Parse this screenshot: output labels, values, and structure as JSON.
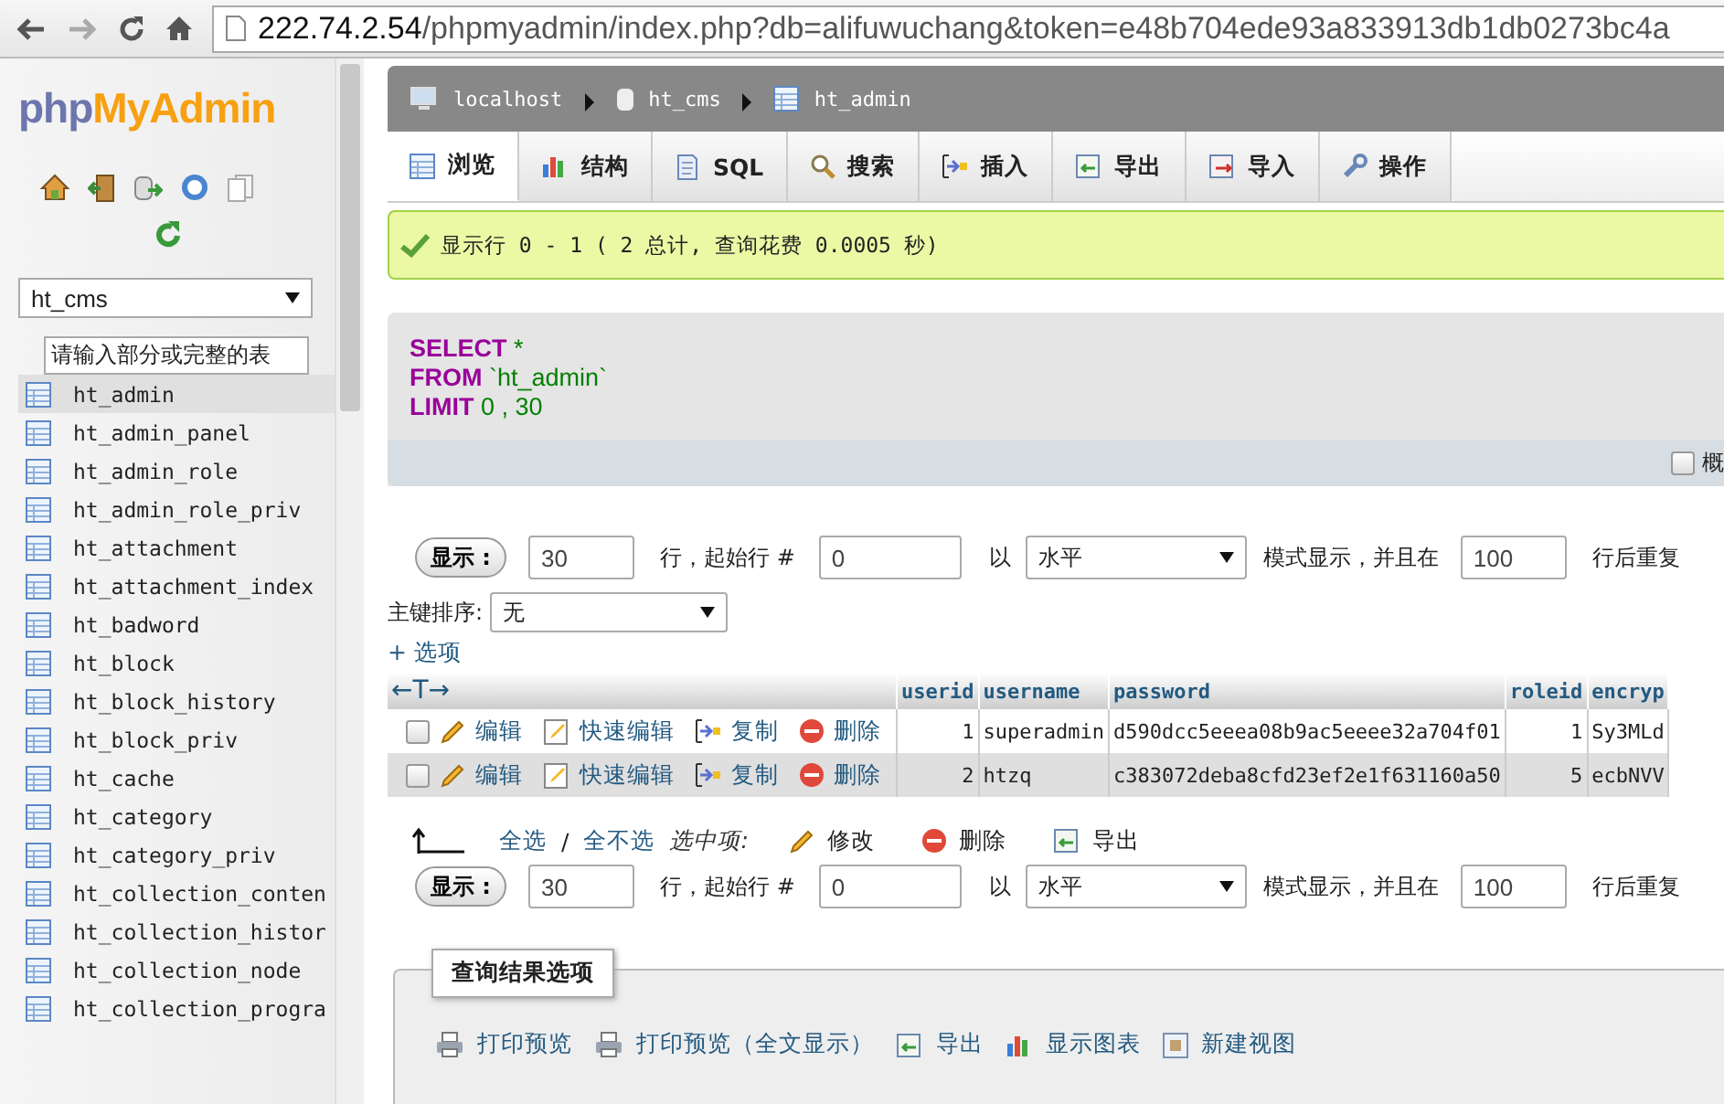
{
  "browser": {
    "url_host": "222.74.2.54",
    "url_path": "/phpmyadmin/index.php?db=alifuwuchang&token=e48b704ede93a833913db1db0273bc4a"
  },
  "sidebar": {
    "logo_php": "php",
    "logo_myadmin": "MyAdmin",
    "database": "ht_cms",
    "filter_value": "请输入部分或完整的表",
    "tables": [
      {
        "name": "ht_admin",
        "selected": true
      },
      {
        "name": "ht_admin_panel",
        "selected": false
      },
      {
        "name": "ht_admin_role",
        "selected": false
      },
      {
        "name": "ht_admin_role_priv",
        "selected": false
      },
      {
        "name": "ht_attachment",
        "selected": false
      },
      {
        "name": "ht_attachment_index",
        "selected": false
      },
      {
        "name": "ht_badword",
        "selected": false
      },
      {
        "name": "ht_block",
        "selected": false
      },
      {
        "name": "ht_block_history",
        "selected": false
      },
      {
        "name": "ht_block_priv",
        "selected": false
      },
      {
        "name": "ht_cache",
        "selected": false
      },
      {
        "name": "ht_category",
        "selected": false
      },
      {
        "name": "ht_category_priv",
        "selected": false
      },
      {
        "name": "ht_collection_conten",
        "selected": false
      },
      {
        "name": "ht_collection_histor",
        "selected": false
      },
      {
        "name": "ht_collection_node",
        "selected": false
      },
      {
        "name": "ht_collection_progra",
        "selected": false
      }
    ]
  },
  "breadcrumb": [
    "localhost",
    "ht_cms",
    "ht_admin"
  ],
  "tabs": [
    {
      "label": "浏览",
      "selected": true
    },
    {
      "label": "结构",
      "selected": false
    },
    {
      "label": "SQL",
      "selected": false
    },
    {
      "label": "搜索",
      "selected": false
    },
    {
      "label": "插入",
      "selected": false
    },
    {
      "label": "导出",
      "selected": false
    },
    {
      "label": "导入",
      "selected": false
    },
    {
      "label": "操作",
      "selected": false
    }
  ],
  "message": "显示行 0 - 1 ( 2 总计, 查询花费 0.0005 秒)",
  "sql": [
    {
      "keyword": "SELECT",
      "rest": "*"
    },
    {
      "keyword": "FROM",
      "rest": "`ht_admin`"
    },
    {
      "keyword": "LIMIT",
      "rest": "0 , 30"
    }
  ],
  "profiling": {
    "label": "概",
    "checked": false
  },
  "navigation": [
    {
      "show_button": "显示 :",
      "rows": "30",
      "label_start": "行，起始行 #",
      "start": "0",
      "label_mode": "以",
      "mode": "水平",
      "label_repeat": "模式显示，并且在",
      "repeat": "100",
      "label_after": "行后重复"
    }
  ],
  "sort": {
    "label": "主键排序:",
    "value": "无"
  },
  "options_link": "+ 选项",
  "table": {
    "header_arrows": "←T→",
    "columns": [
      "userid",
      "username",
      "password",
      "roleid",
      "encryp"
    ],
    "rows": [
      {
        "checked": false,
        "actions": [
          "编辑",
          "快速编辑",
          "复制",
          "删除"
        ],
        "cells": [
          "1",
          "superadmin",
          "d590dcc5eeea08b9ac5eeee32a704f01",
          "1",
          "Sy3MLd"
        ]
      },
      {
        "checked": false,
        "actions": [
          "编辑",
          "快速编辑",
          "复制",
          "删除"
        ],
        "cells": [
          "2",
          "htzq",
          "c383072deba8cfd23ef2e1f631160a50",
          "5",
          "ecbNVV"
        ]
      }
    ]
  },
  "bulk": {
    "check_all": "全选",
    "separator": "/",
    "uncheck_all": "全不选",
    "with_selected": "选中项:",
    "actions": [
      "修改",
      "删除",
      "导出"
    ]
  },
  "navigation_bottom": {
    "show_button": "显示 :",
    "rows": "30",
    "label_start": "行，起始行 #",
    "start": "0",
    "label_mode": "以",
    "mode": "水平",
    "label_repeat": "模式显示，并且在",
    "repeat": "100",
    "label_after": "行后重复"
  },
  "result_options": {
    "legend": "查询结果选项",
    "links": [
      "打印预览",
      "打印预览（全文显示）",
      "导出",
      "显示图表",
      "新建视图"
    ]
  }
}
